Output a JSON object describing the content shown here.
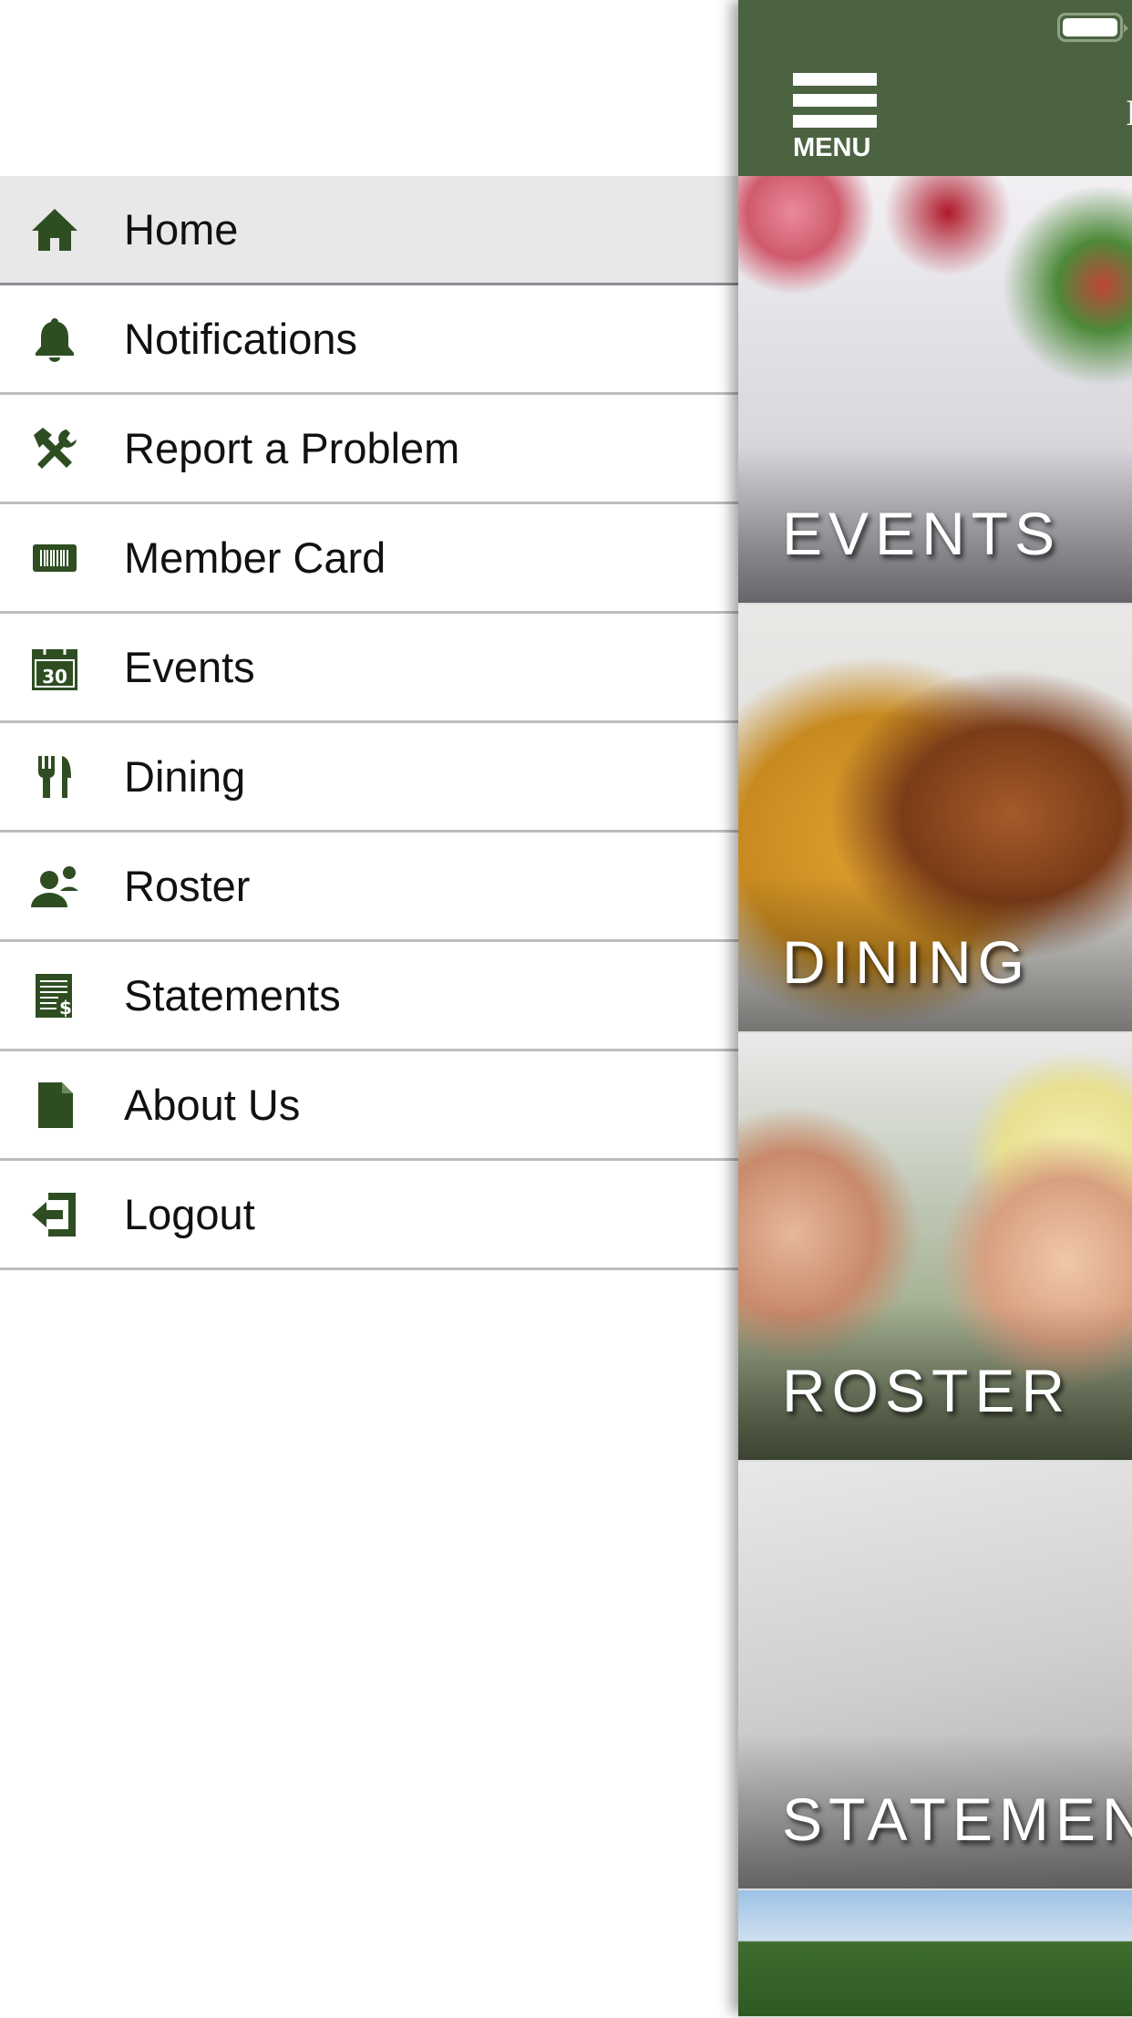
{
  "drawer": {
    "items": [
      {
        "label": "Home",
        "icon": "home-icon",
        "active": true
      },
      {
        "label": "Notifications",
        "icon": "bell-icon"
      },
      {
        "label": "Report a Problem",
        "icon": "tools-icon"
      },
      {
        "label": "Member Card",
        "icon": "barcode-icon"
      },
      {
        "label": "Events",
        "icon": "calendar-icon",
        "icon_text": "30"
      },
      {
        "label": "Dining",
        "icon": "fork-knife-icon"
      },
      {
        "label": "Roster",
        "icon": "person-icon"
      },
      {
        "label": "Statements",
        "icon": "statement-icon"
      },
      {
        "label": "About Us",
        "icon": "document-icon"
      },
      {
        "label": "Logout",
        "icon": "logout-icon"
      }
    ],
    "icon_color": "#2e4e22"
  },
  "header": {
    "menu_label": "MENU",
    "title_fragment": "I",
    "bg_color": "#4b6341"
  },
  "tiles": [
    {
      "label": "EVENTS"
    },
    {
      "label": "DINING"
    },
    {
      "label": "ROSTER"
    },
    {
      "label": "STATEMENTS"
    }
  ]
}
